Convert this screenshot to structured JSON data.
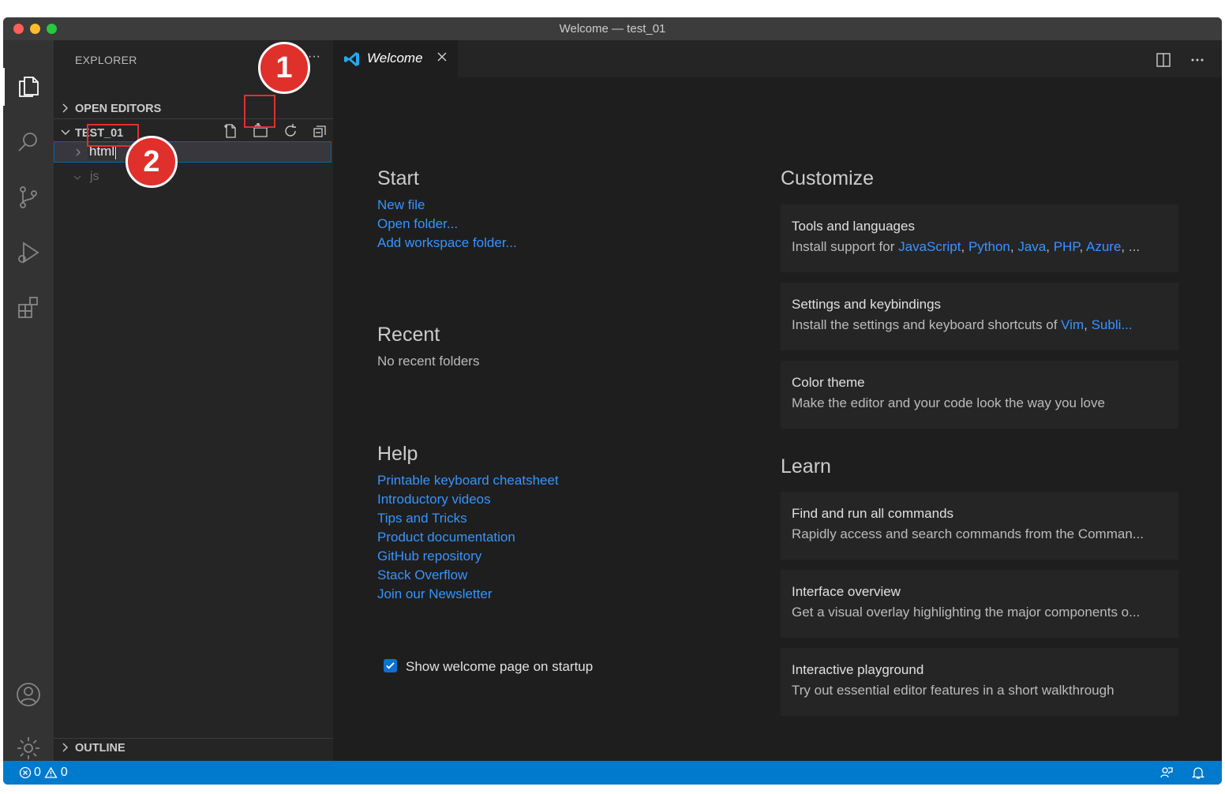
{
  "window": {
    "title": "Welcome — test_01"
  },
  "activity_bar": [
    "explorer-icon",
    "search-icon",
    "source-control-icon",
    "run-debug-icon",
    "extensions-icon",
    "accounts-icon",
    "settings-icon"
  ],
  "sidebar": {
    "title": "EXPLORER",
    "more": "···",
    "open_editors_label": "OPEN EDITORS",
    "folder_label": "TEST_01",
    "rename_value": "html",
    "tree": [
      {
        "label": "js"
      }
    ],
    "outline_label": "OUTLINE"
  },
  "annotations": [
    "1",
    "2"
  ],
  "tab": {
    "label": "Welcome"
  },
  "welcome": {
    "start_heading": "Start",
    "start_links": [
      "New file",
      "Open folder...",
      "Add workspace folder..."
    ],
    "recent_heading": "Recent",
    "recent_empty": "No recent folders",
    "help_heading": "Help",
    "help_links": [
      "Printable keyboard cheatsheet",
      "Introductory videos",
      "Tips and Tricks",
      "Product documentation",
      "GitHub repository",
      "Stack Overflow",
      "Join our Newsletter"
    ],
    "show_on_startup": "Show welcome page on startup",
    "show_on_startup_checked": true,
    "customize_heading": "Customize",
    "learn_heading": "Learn",
    "cards": {
      "tools": {
        "title": "Tools and languages",
        "prefix": "Install support for ",
        "links": [
          "JavaScript",
          "Python",
          "Java",
          "PHP",
          "Azure"
        ],
        "suffix": ", ..."
      },
      "settings": {
        "title": "Settings and keybindings",
        "prefix": "Install the settings and keyboard shortcuts of ",
        "links": [
          "Vim",
          "Subli..."
        ]
      },
      "color": {
        "title": "Color theme",
        "desc": "Make the editor and your code look the way you love"
      },
      "commands": {
        "title": "Find and run all commands",
        "desc": "Rapidly access and search commands from the Comman..."
      },
      "interface": {
        "title": "Interface overview",
        "desc": "Get a visual overlay highlighting the major components o..."
      },
      "playground": {
        "title": "Interactive playground",
        "desc": "Try out essential editor features in a short walkthrough"
      }
    }
  },
  "status": {
    "errors": "0",
    "warnings": "0"
  },
  "colors": {
    "accent": "#007acc",
    "link": "#3794ff",
    "annotation": "#e0302b"
  }
}
